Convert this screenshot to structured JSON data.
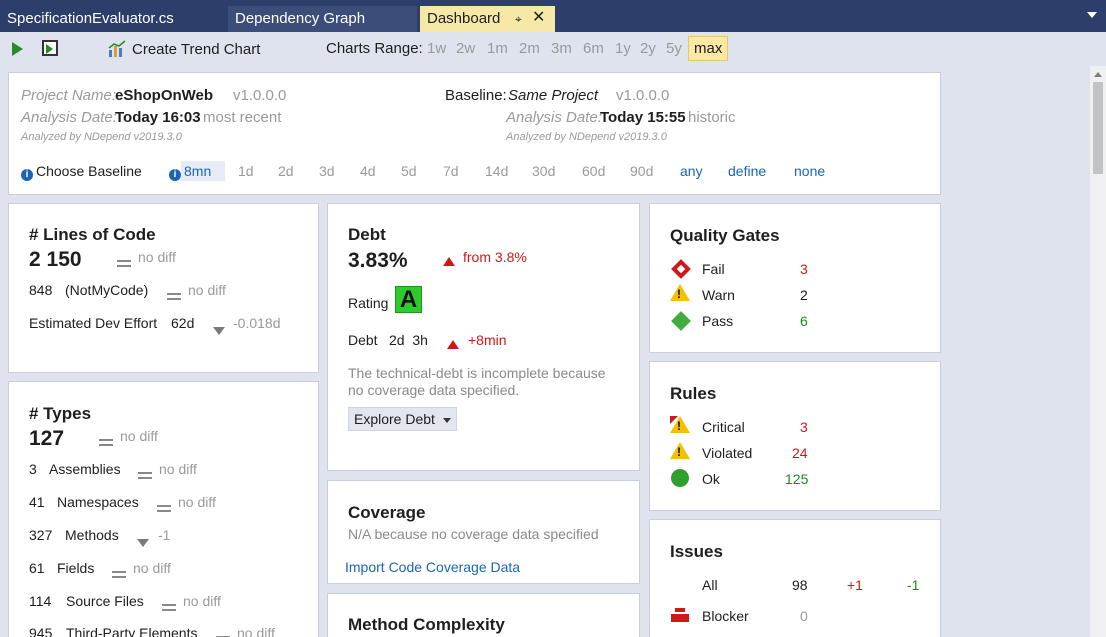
{
  "tabs": [
    {
      "label": "SpecificationEvaluator.cs"
    },
    {
      "label": "Dependency Graph"
    },
    {
      "label": "Dashboard",
      "pin": "⌖",
      "close": "✕"
    }
  ],
  "toolbar": {
    "create_trend": "Create Trend Chart",
    "range_label": "Charts Range:",
    "ranges": [
      "1w",
      "2w",
      "1m",
      "2m",
      "3m",
      "6m",
      "1y",
      "2y",
      "5y",
      "max"
    ],
    "selected_range": "max"
  },
  "project": {
    "name_label": "Project Name:",
    "name": "eShopOnWeb",
    "version": "v1.0.0.0",
    "date_label": "Analysis Date:",
    "date": "Today 16:03",
    "date_note": "most recent",
    "analyzed_by": "Analyzed by NDepend v2019.3.0"
  },
  "baseline": {
    "label": "Baseline:",
    "name": "Same Project",
    "version": "v1.0.0.0",
    "date_label": "Analysis Date:",
    "date": "Today 15:55",
    "date_note": "historic",
    "analyzed_by": "Analyzed by NDepend v2019.3.0",
    "choose_label": "Choose Baseline",
    "options": [
      "8mn",
      "1d",
      "2d",
      "3d",
      "4d",
      "5d",
      "7d",
      "14d",
      "30d",
      "60d",
      "90d"
    ],
    "selected": "8mn",
    "links": [
      "any",
      "define",
      "none"
    ]
  },
  "loc": {
    "title": "# Lines of Code",
    "value": "2 150",
    "diff": "no diff",
    "notmycode_value": "848",
    "notmycode_label": "(NotMyCode)",
    "notmycode_diff": "no diff",
    "effort_label": "Estimated Dev Effort",
    "effort_value": "62d",
    "effort_diff": "-0.018d"
  },
  "types": {
    "title": "# Types",
    "value": "127",
    "diff": "no diff",
    "rows": [
      {
        "value": "3",
        "label": "Assemblies",
        "diff": "no diff"
      },
      {
        "value": "41",
        "label": "Namespaces",
        "diff": "no diff"
      },
      {
        "value": "327",
        "label": "Methods",
        "diff": "-1"
      },
      {
        "value": "61",
        "label": "Fields",
        "diff": "no diff"
      },
      {
        "value": "114",
        "label": "Source Files",
        "diff": "no diff"
      },
      {
        "value": "945",
        "label": "Third-Party Elements",
        "diff": "no diff"
      }
    ]
  },
  "debt": {
    "title": "Debt",
    "value": "3.83%",
    "change": "from 3.8%",
    "rating_label": "Rating",
    "rating": "A",
    "debt_label": "Debt",
    "debt_value": "2d  3h",
    "debt_change": "+8min",
    "note_line1": "The technical-debt is incomplete because",
    "note_line2": "no coverage data specified.",
    "explore": "Explore Debt"
  },
  "coverage": {
    "title": "Coverage",
    "note": "N/A because no coverage data specified",
    "import_link": "Import Code Coverage Data"
  },
  "complexity": {
    "title": "Method Complexity"
  },
  "quality_gates": {
    "title": "Quality Gates",
    "rows": [
      {
        "label": "Fail",
        "value": "3"
      },
      {
        "label": "Warn",
        "value": "2"
      },
      {
        "label": "Pass",
        "value": "6"
      }
    ]
  },
  "rules": {
    "title": "Rules",
    "rows": [
      {
        "label": "Critical",
        "value": "3"
      },
      {
        "label": "Violated",
        "value": "24"
      },
      {
        "label": "Ok",
        "value": "125"
      }
    ]
  },
  "issues": {
    "title": "Issues",
    "rows": [
      {
        "label": "All",
        "value": "98",
        "added": "+1",
        "removed": "-1"
      },
      {
        "label": "Blocker",
        "value": "0"
      }
    ]
  },
  "colors": {
    "tab_active": "#f6e8a6",
    "tabbar": "#2d3e6b",
    "accent_red": "#d01818",
    "accent_green": "#1f8a1f",
    "link": "#1a66b5",
    "rating_green": "#2ecb2e"
  }
}
